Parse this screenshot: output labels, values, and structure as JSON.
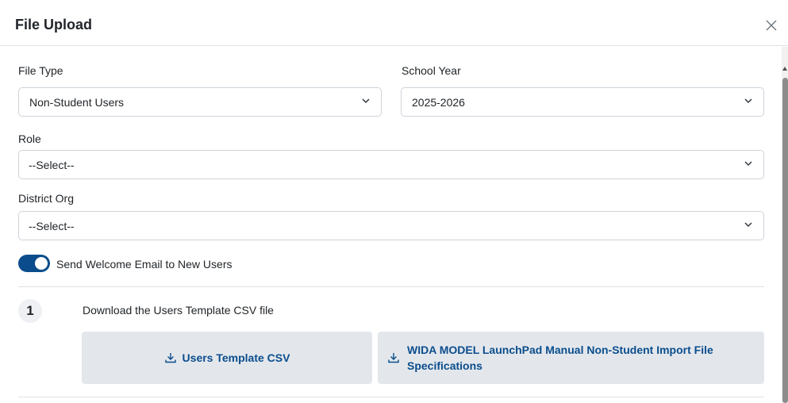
{
  "modal": {
    "title": "File Upload",
    "close_icon": "close-icon"
  },
  "form": {
    "file_type": {
      "label": "File Type",
      "value": "Non-Student Users"
    },
    "school_year": {
      "label": "School Year",
      "value": "2025-2026"
    },
    "role": {
      "label": "Role",
      "value": "--Select--"
    },
    "district_org": {
      "label": "District Org",
      "value": "--Select--"
    },
    "welcome_email": {
      "label": "Send Welcome Email to New Users",
      "checked": true
    }
  },
  "steps": [
    {
      "number": "1",
      "text": "Download the Users Template CSV file",
      "buttons": [
        {
          "label": "Users Template CSV",
          "icon": "download-icon"
        },
        {
          "label": "WIDA MODEL LaunchPad Manual Non-Student Import File Specifications",
          "icon": "download-icon"
        }
      ]
    }
  ],
  "colors": {
    "accent": "#0b4d8c",
    "button_bg": "#e3e7ec",
    "border": "#ced4da"
  }
}
